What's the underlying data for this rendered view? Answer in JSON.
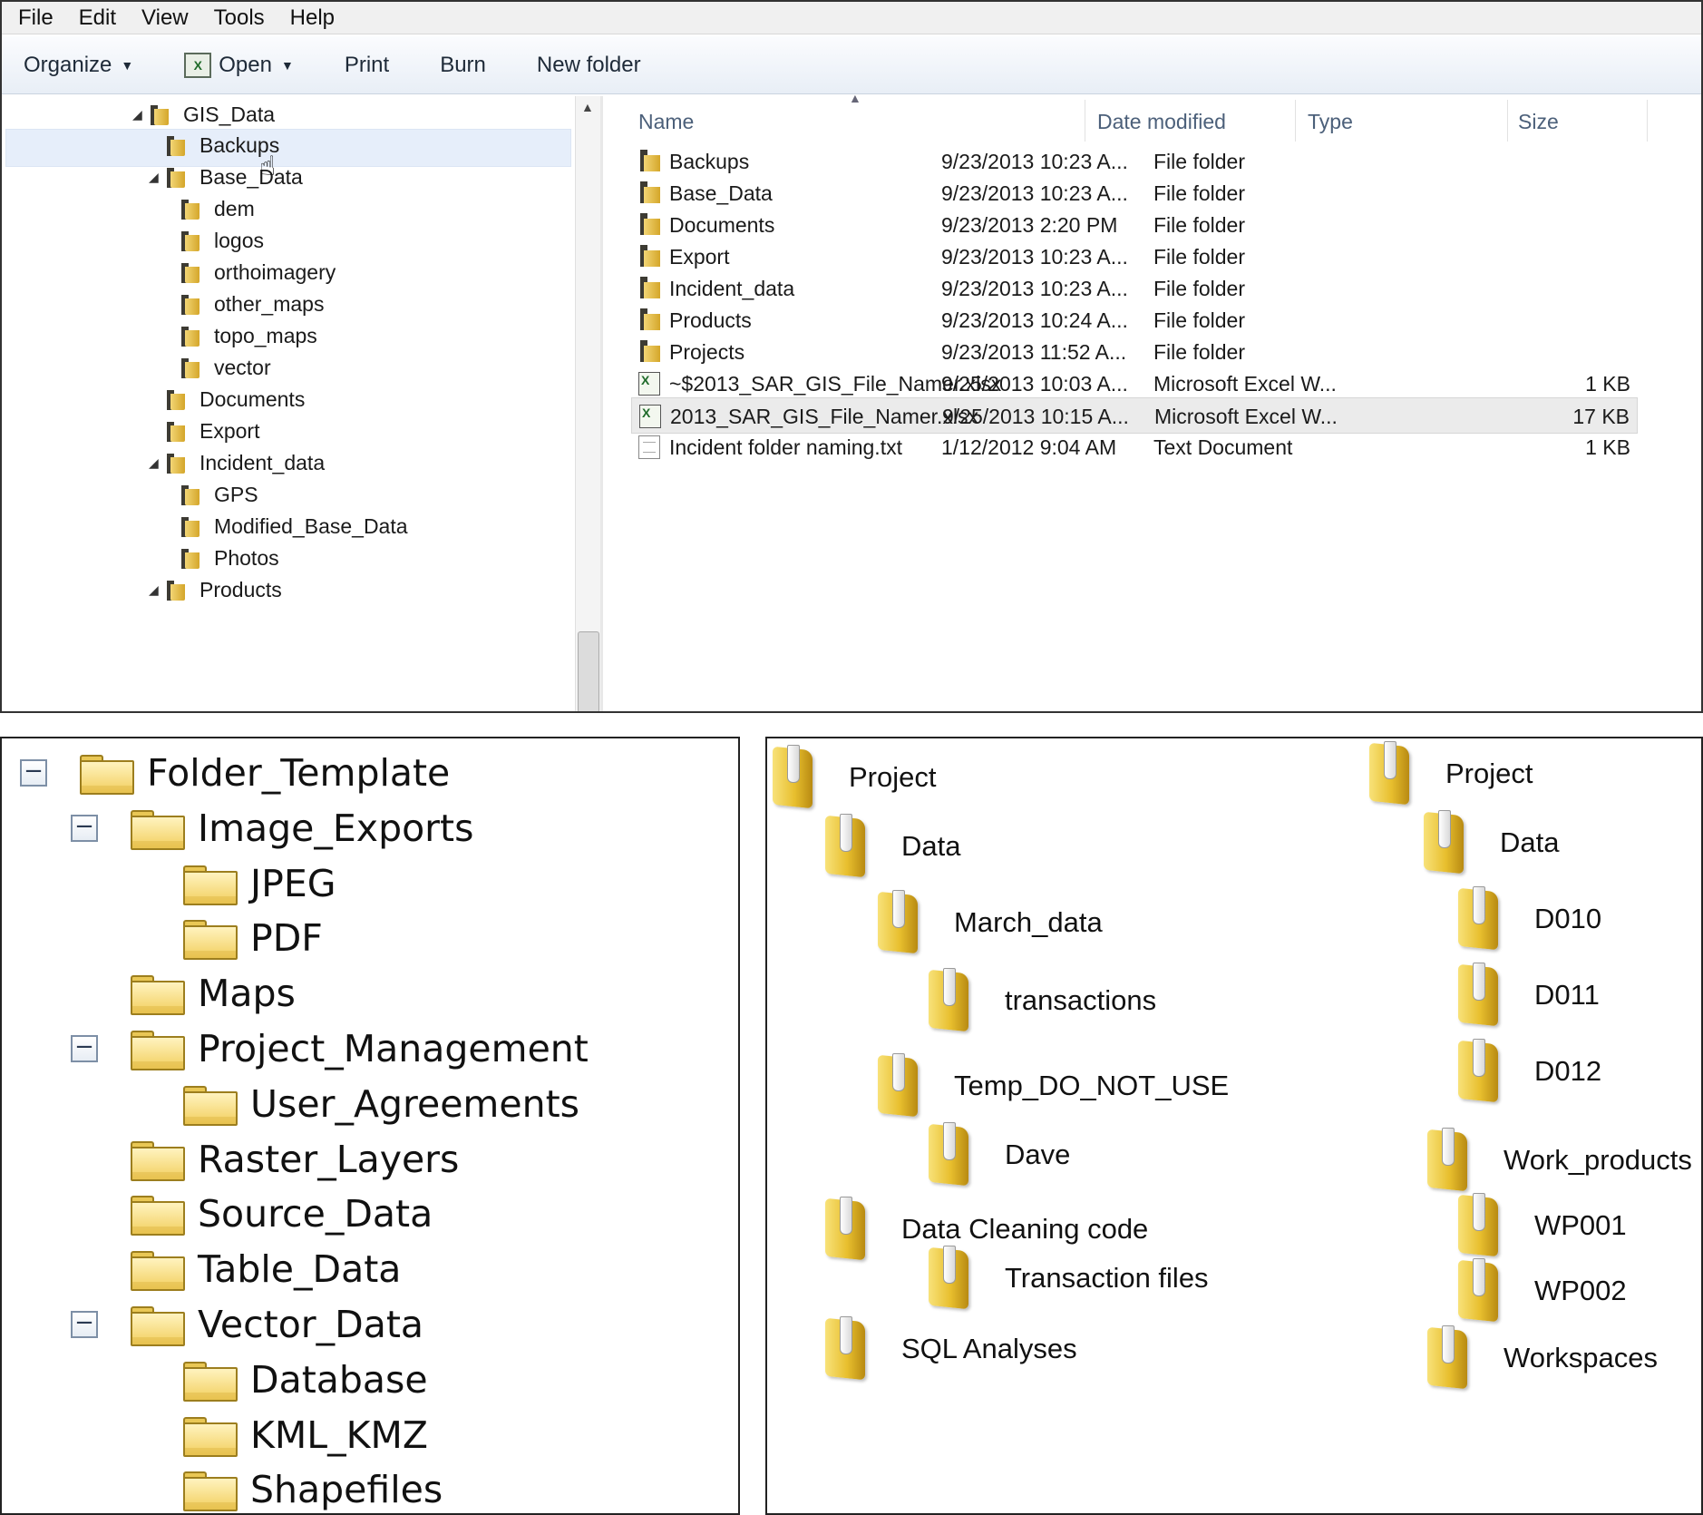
{
  "explorer": {
    "menu": [
      "File",
      "Edit",
      "View",
      "Tools",
      "Help"
    ],
    "toolbar": {
      "organize": "Organize",
      "open": "Open",
      "print": "Print",
      "burn": "Burn",
      "new_folder": "New folder"
    },
    "nav_tree": [
      {
        "label": "GIS_Data",
        "expanded": true
      },
      {
        "label": "Backups",
        "selected": true
      },
      {
        "label": "Base_Data",
        "expanded": true
      },
      {
        "label": "dem"
      },
      {
        "label": "logos"
      },
      {
        "label": "orthoimagery"
      },
      {
        "label": "other_maps"
      },
      {
        "label": "topo_maps"
      },
      {
        "label": "vector"
      },
      {
        "label": "Documents"
      },
      {
        "label": "Export"
      },
      {
        "label": "Incident_data",
        "expanded": true
      },
      {
        "label": "GPS"
      },
      {
        "label": "Modified_Base_Data"
      },
      {
        "label": "Photos"
      },
      {
        "label": "Products",
        "expanded": true
      }
    ],
    "columns": {
      "name": "Name",
      "date": "Date modified",
      "type": "Type",
      "size": "Size"
    },
    "files": [
      {
        "name": "Backups",
        "date": "9/23/2013 10:23 A...",
        "type": "File folder",
        "size": "",
        "icon": "folder-icon"
      },
      {
        "name": "Base_Data",
        "date": "9/23/2013 10:23 A...",
        "type": "File folder",
        "size": "",
        "icon": "folder-icon"
      },
      {
        "name": "Documents",
        "date": "9/23/2013 2:20 PM",
        "type": "File folder",
        "size": "",
        "icon": "folder-icon"
      },
      {
        "name": "Export",
        "date": "9/23/2013 10:23 A...",
        "type": "File folder",
        "size": "",
        "icon": "folder-icon"
      },
      {
        "name": "Incident_data",
        "date": "9/23/2013 10:23 A...",
        "type": "File folder",
        "size": "",
        "icon": "folder-icon"
      },
      {
        "name": "Products",
        "date": "9/23/2013 10:24 A...",
        "type": "File folder",
        "size": "",
        "icon": "folder-icon"
      },
      {
        "name": "Projects",
        "date": "9/23/2013 11:52 A...",
        "type": "File folder",
        "size": "",
        "icon": "folder-icon"
      },
      {
        "name": "~$2013_SAR_GIS_File_Namer.xlsx",
        "date": "9/25/2013 10:03 A...",
        "type": "Microsoft Excel W...",
        "size": "1 KB",
        "icon": "excel-icon"
      },
      {
        "name": "2013_SAR_GIS_File_Namer.xlsx",
        "date": "9/25/2013 10:15 A...",
        "type": "Microsoft Excel W...",
        "size": "17 KB",
        "icon": "excel-icon",
        "selected": true
      },
      {
        "name": "Incident folder naming.txt",
        "date": "1/12/2012 9:04 AM",
        "type": "Text Document",
        "size": "1 KB",
        "icon": "text-file-icon"
      }
    ]
  },
  "folder_template_tree": [
    {
      "label": "Folder_Template",
      "collapsible": true
    },
    {
      "label": "Image_Exports",
      "collapsible": true
    },
    {
      "label": "JPEG"
    },
    {
      "label": "PDF"
    },
    {
      "label": "Maps"
    },
    {
      "label": "Project_Management",
      "collapsible": true
    },
    {
      "label": "User_Agreements"
    },
    {
      "label": "Raster_Layers"
    },
    {
      "label": "Source_Data"
    },
    {
      "label": "Table_Data"
    },
    {
      "label": "Vector_Data",
      "collapsible": true
    },
    {
      "label": "Database"
    },
    {
      "label": "KML_KMZ"
    },
    {
      "label": "Shapefiles"
    }
  ],
  "project_tree_a": [
    "Project",
    "Data",
    "March_data",
    "transactions",
    "Temp_DO_NOT_USE",
    "Dave",
    "Data Cleaning code",
    "Transaction files",
    "SQL Analyses"
  ],
  "project_tree_b": [
    "Project",
    "Data",
    "D010",
    "D011",
    "D012",
    "Work_products",
    "WP001",
    "WP002",
    "Workspaces"
  ]
}
